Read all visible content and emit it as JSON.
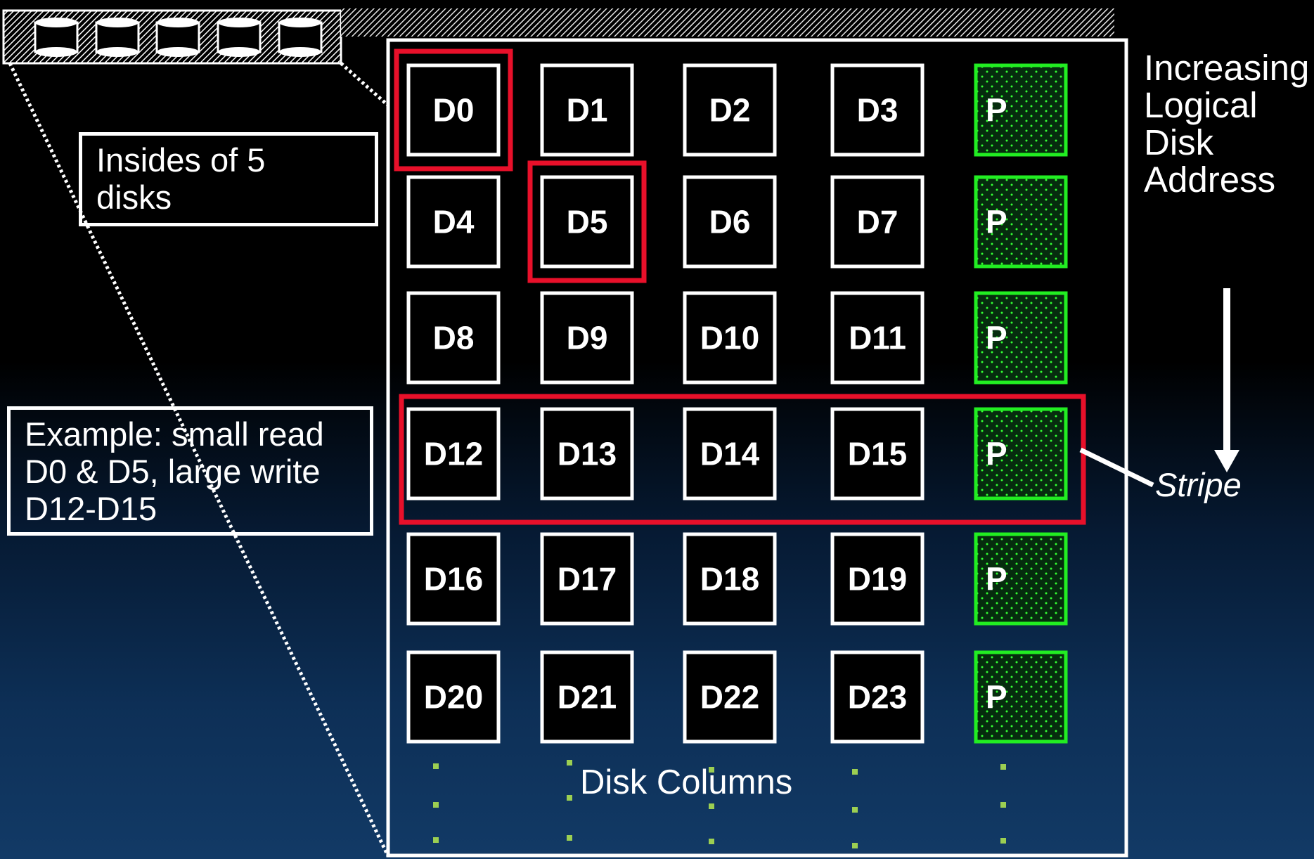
{
  "callouts": {
    "insides": [
      "Insides of 5",
      "disks"
    ],
    "example": [
      "Example: small read",
      "D0 & D5, large write",
      "D12-D15"
    ]
  },
  "side_label": [
    "Increasing",
    "Logical",
    "Disk",
    "Address"
  ],
  "stripe_label": "Stripe",
  "columns_label": "Disk Columns",
  "grid": {
    "rows": [
      [
        "D0",
        "D1",
        "D2",
        "D3",
        "P"
      ],
      [
        "D4",
        "D5",
        "D6",
        "D7",
        "P"
      ],
      [
        "D8",
        "D9",
        "D10",
        "D11",
        "P"
      ],
      [
        "D12",
        "D13",
        "D14",
        "D15",
        "P"
      ],
      [
        "D16",
        "D17",
        "D18",
        "D19",
        "P"
      ],
      [
        "D20",
        "D21",
        "D22",
        "D23",
        "P"
      ]
    ],
    "highlighted_blocks": [
      "D0",
      "D5"
    ],
    "highlighted_stripe": [
      "D12",
      "D13",
      "D14",
      "D15",
      "P"
    ]
  },
  "colors": {
    "block_border": "#ffffff",
    "parity_border": "#22ee22",
    "parity_fill": "#0a3a12",
    "highlight": "#e8102a",
    "text": "#ffffff"
  },
  "icons": [
    "disk-stack-icon",
    "down-arrow-icon",
    "pointer-line-icon"
  ]
}
